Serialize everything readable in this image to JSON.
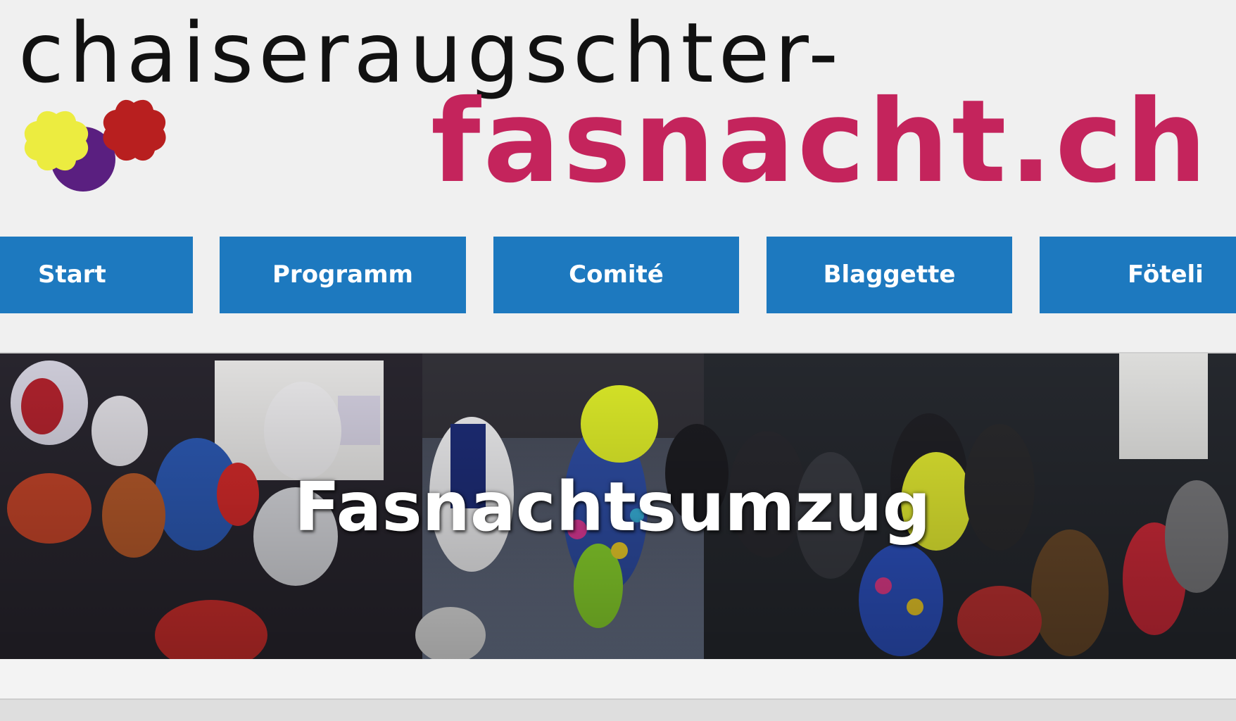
{
  "header": {
    "title_line1": "chaiseraugschter-",
    "title_line2": "fasnacht.ch"
  },
  "logo": {
    "icon": "carnival-logo-icon",
    "colors": {
      "yellow": "#ecec40",
      "purple": "#5a1f80",
      "red": "#b81f1f"
    }
  },
  "nav": {
    "items": [
      {
        "label": "Start"
      },
      {
        "label": "Programm"
      },
      {
        "label": "Comité"
      },
      {
        "label": "Blaggette"
      },
      {
        "label": "Föteli"
      }
    ]
  },
  "hero": {
    "title": "Fasnachtsumzug"
  },
  "colors": {
    "background": "#f0f0f0",
    "nav_blue": "#1d79bf",
    "brand_pink": "#c4245c",
    "title_black": "#111111"
  }
}
